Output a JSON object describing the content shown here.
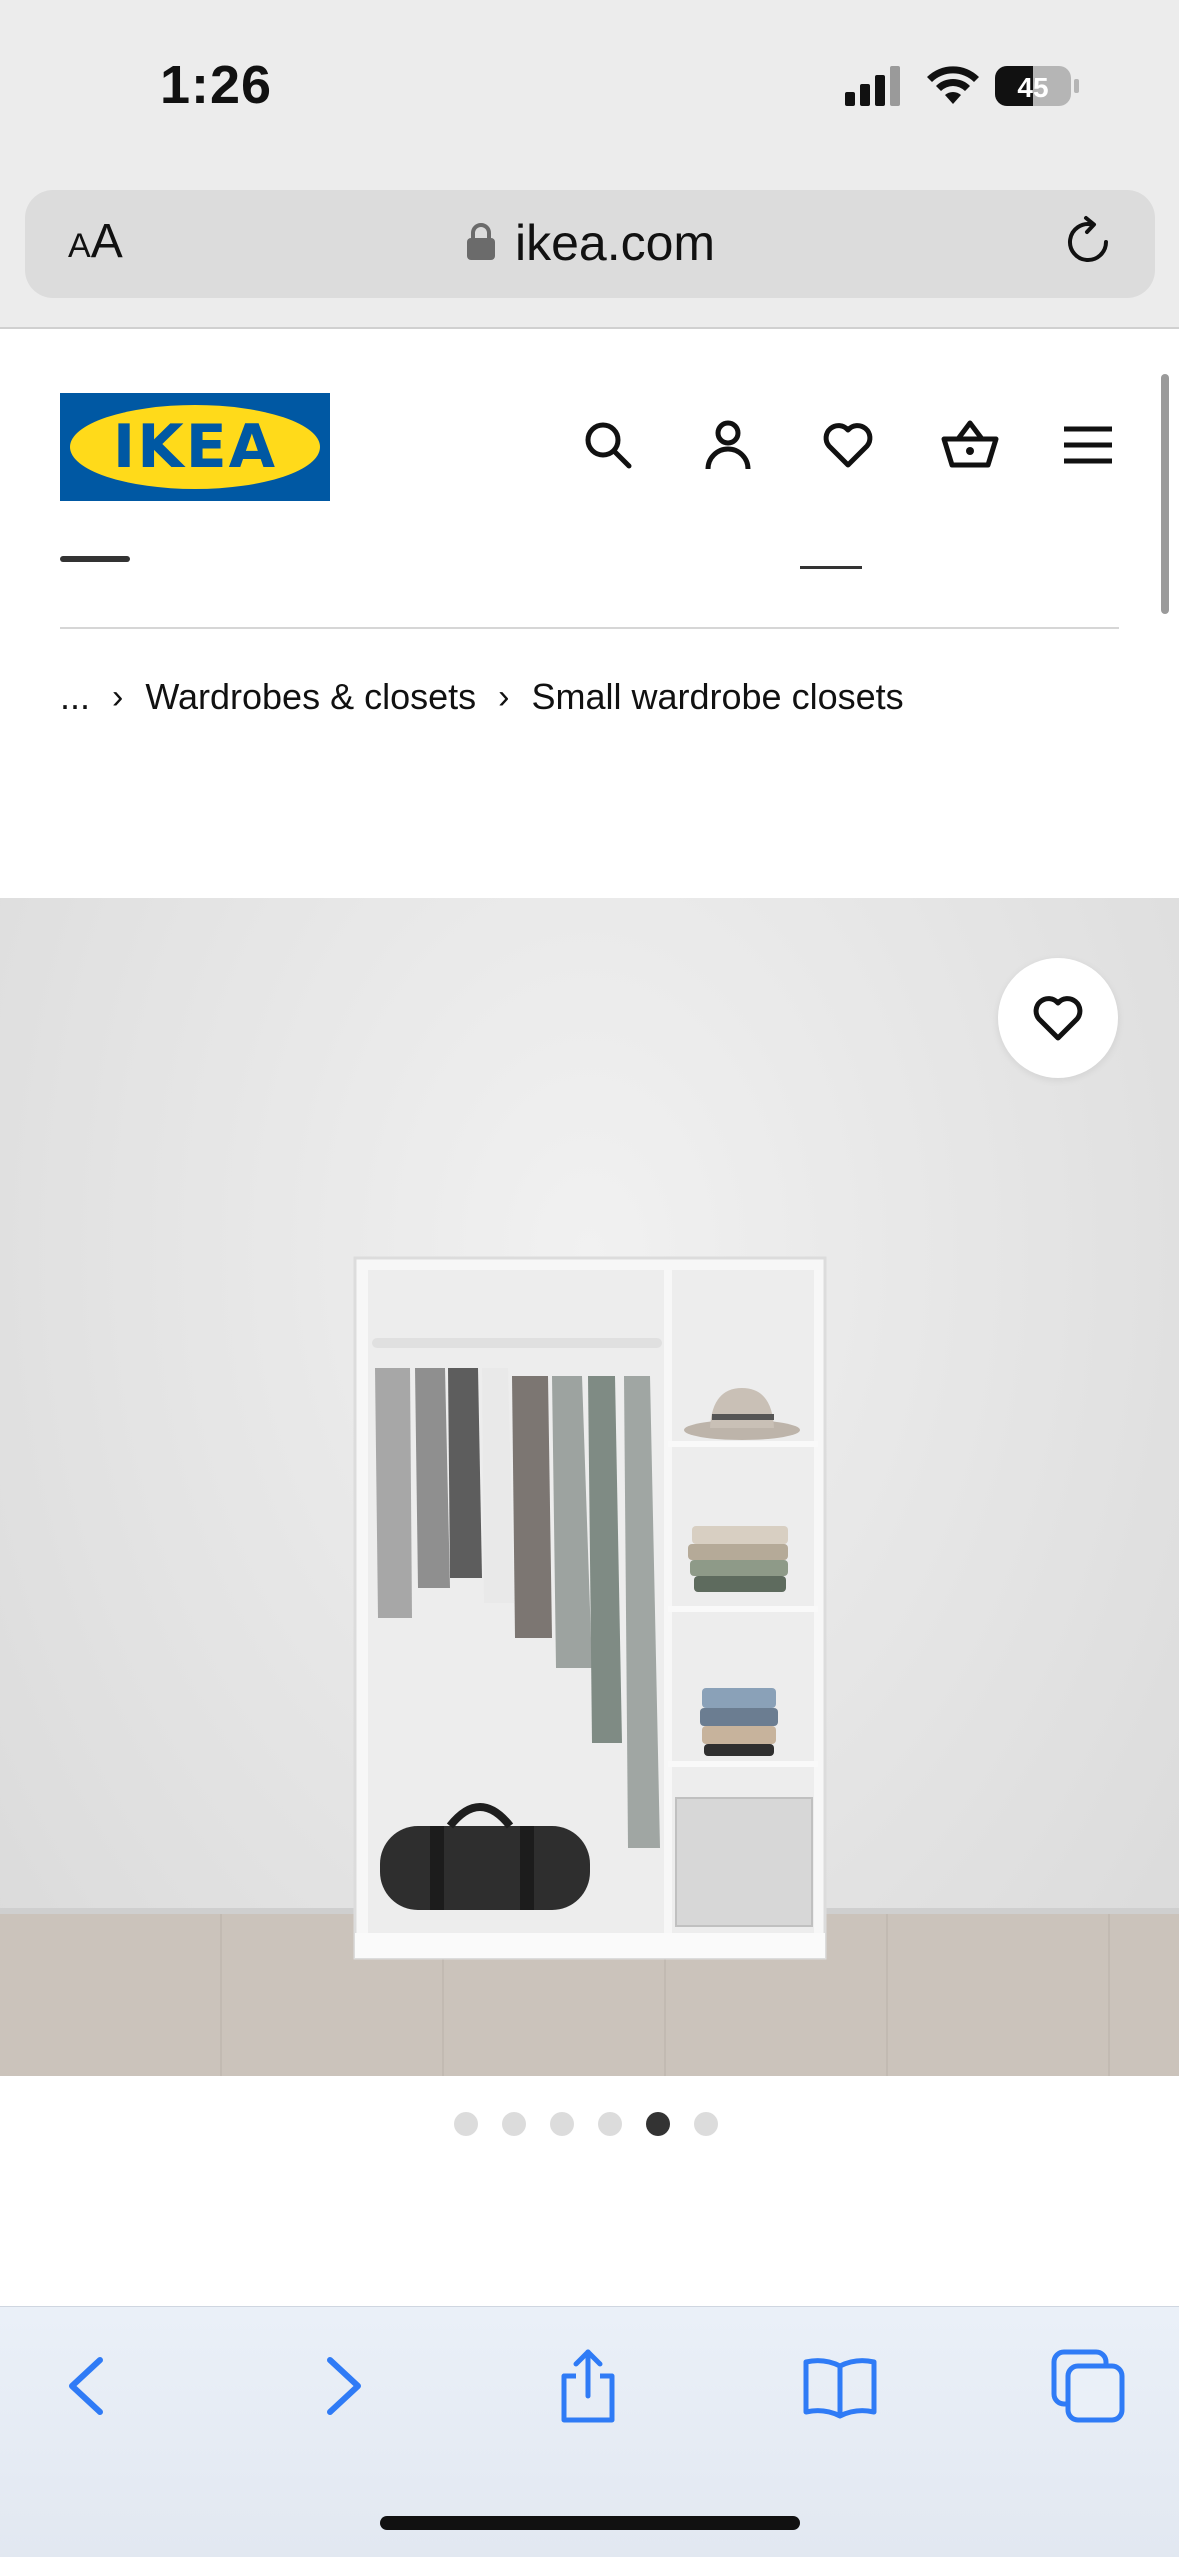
{
  "status_bar": {
    "time": "1:26",
    "battery_level": "45",
    "icons": [
      "signal-icon",
      "wifi-icon",
      "battery-icon"
    ]
  },
  "browser": {
    "text_size_small": "A",
    "text_size_large": "A",
    "url": "ikea.com",
    "icons": [
      "lock-icon",
      "reload-icon"
    ]
  },
  "header": {
    "logo_text": "IKEA",
    "icons": [
      "search-icon",
      "account-icon",
      "heart-icon",
      "cart-icon",
      "menu-icon"
    ]
  },
  "breadcrumb": {
    "items": [
      "...",
      "Wardrobes & closets",
      "Small wardrobe closets"
    ],
    "separator": "›"
  },
  "gallery": {
    "dot_count": 6,
    "active_index": 4
  },
  "toolbar": {
    "icons": [
      "back-icon",
      "forward-icon",
      "share-icon",
      "bookmarks-icon",
      "tabs-icon"
    ]
  },
  "colors": {
    "ikea_blue": "#0058a3",
    "ikea_yellow": "#ffda1a",
    "safari_blue": "#2f7bf6"
  }
}
